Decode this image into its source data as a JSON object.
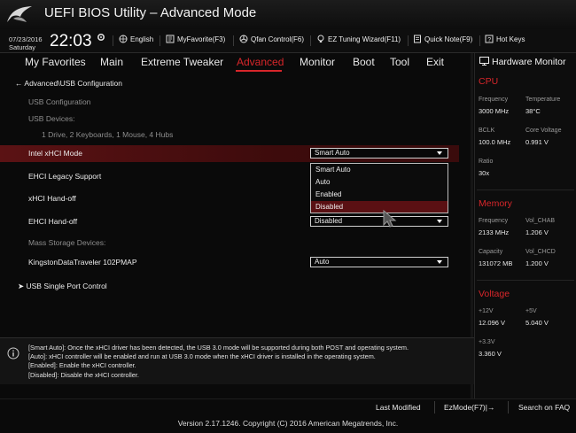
{
  "app": {
    "title": "UEFI BIOS Utility – Advanced Mode"
  },
  "infobar": {
    "date": "07/23/2016",
    "day": "Saturday",
    "time": "22:03",
    "tools": [
      {
        "label": "English",
        "icon": "globe-icon"
      },
      {
        "label": "MyFavorite(F3)",
        "icon": "favorite-icon"
      },
      {
        "label": "Qfan Control(F6)",
        "icon": "fan-icon"
      },
      {
        "label": "EZ Tuning Wizard(F11)",
        "icon": "bulb-icon"
      },
      {
        "label": "Quick Note(F9)",
        "icon": "note-icon"
      },
      {
        "label": "Hot Keys",
        "icon": "help-icon"
      }
    ]
  },
  "menu": {
    "items": [
      "My Favorites",
      "Main",
      "Extreme Tweaker",
      "Advanced",
      "Monitor",
      "Boot",
      "Tool",
      "Exit"
    ],
    "active": "Advanced",
    "accent_color": "#d8262a"
  },
  "main": {
    "breadcrumb": "Advanced\\USB Configuration",
    "section_title": "USB Configuration",
    "usb_devices_label": "USB Devices:",
    "usb_devices_value": "1 Drive, 2 Keyboards, 1 Mouse, 4 Hubs",
    "settings": [
      {
        "label": "Intel xHCI Mode",
        "value": "Smart Auto"
      },
      {
        "label": "EHCI Legacy Support",
        "value": ""
      },
      {
        "label": "xHCI Hand-off",
        "value": ""
      },
      {
        "label": "EHCI Hand-off",
        "value": "Disabled"
      }
    ],
    "mass_storage_label": "Mass Storage Devices:",
    "mass_storage_device": {
      "label": "KingstonDataTraveler 102PMAP",
      "value": "Auto"
    },
    "submenu": "USB Single Port Control",
    "dropdown_options": [
      "Smart Auto",
      "Auto",
      "Enabled",
      "Disabled"
    ],
    "dropdown_highlighted": "Disabled"
  },
  "help": {
    "lines": [
      "[Smart Auto]: Once the xHCI driver has been detected, the USB 3.0 mode will be supported during both POST and operating system.",
      "[Auto]: xHCI controller will be enabled and run at USB 3.0 mode when the xHCI driver is installed in the operating system.",
      "[Enabled]: Enable the xHCI controller.",
      "[Disabled]: Disable the xHCI controller."
    ]
  },
  "hardware_monitor": {
    "title": "Hardware Monitor",
    "cpu": {
      "heading": "CPU",
      "frequency_label": "Frequency",
      "frequency": "3000 MHz",
      "temperature_label": "Temperature",
      "temperature": "38°C",
      "bclk_label": "BCLK",
      "bclk": "100.0 MHz",
      "core_voltage_label": "Core Voltage",
      "core_voltage": "0.991 V",
      "ratio_label": "Ratio",
      "ratio": "30x"
    },
    "memory": {
      "heading": "Memory",
      "frequency_label": "Frequency",
      "frequency": "2133 MHz",
      "vol_chab_label": "Vol_CHAB",
      "vol_chab": "1.206 V",
      "capacity_label": "Capacity",
      "capacity": "131072 MB",
      "vol_chcd_label": "Vol_CHCD",
      "vol_chcd": "1.200 V"
    },
    "voltage": {
      "heading": "Voltage",
      "v12_label": "+12V",
      "v12": "12.096 V",
      "v5_label": "+5V",
      "v5": "5.040 V",
      "v33_label": "+3.3V",
      "v33": "3.360 V"
    }
  },
  "bottom": {
    "last_modified": "Last Modified",
    "ezmode": "EzMode(F7)|→",
    "search": "Search on FAQ",
    "version": "Version 2.17.1246. Copyright (C) 2016 American Megatrends, Inc."
  }
}
